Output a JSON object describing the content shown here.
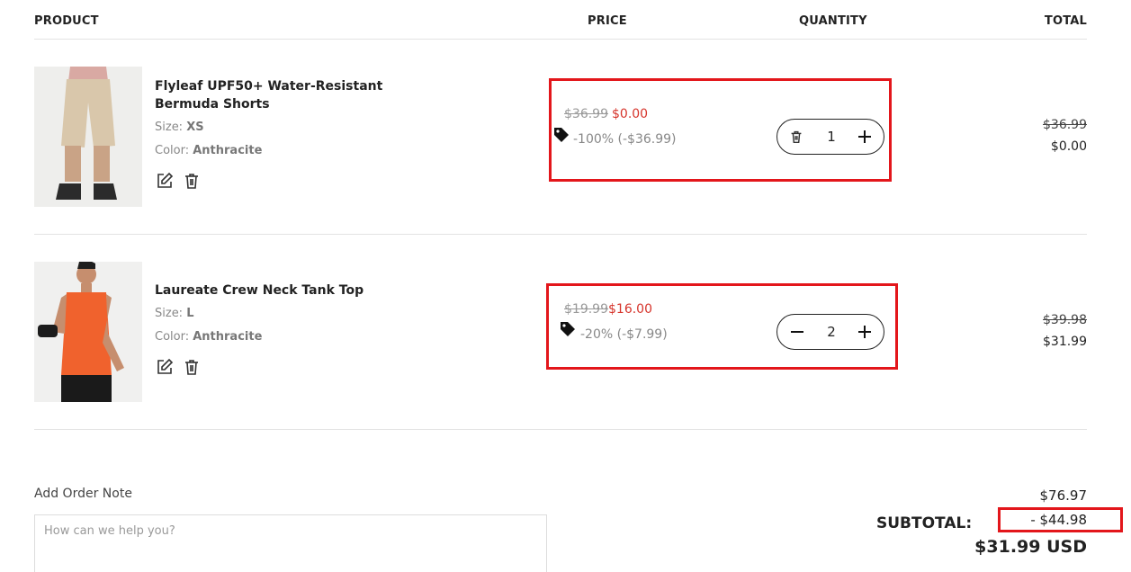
{
  "headers": {
    "product": "PRODUCT",
    "price": "PRICE",
    "quantity": "QUANTITY",
    "total": "TOTAL"
  },
  "items": [
    {
      "name": "Flyleaf UPF50+ Water-Resistant Bermuda Shorts",
      "size_label": "Size:",
      "size": "XS",
      "color_label": "Color:",
      "color": "Anthracite",
      "price_original": "$36.99",
      "price_sale": "$0.00",
      "discount": "-100% (-$36.99)",
      "quantity": "1",
      "total_original": "$36.99",
      "total_sale": "$0.00",
      "image_icon": "shorts-product-photo"
    },
    {
      "name": "Laureate Crew Neck Tank Top",
      "size_label": "Size:",
      "size": "L",
      "color_label": "Color:",
      "color": "Anthracite",
      "price_original": "$19.99",
      "price_sale": "$16.00",
      "discount": "-20% (-$7.99)",
      "quantity": "2",
      "total_original": "$39.98",
      "total_sale": "$31.99",
      "image_icon": "tank-top-product-photo"
    }
  ],
  "order_note": {
    "label": "Add Order Note",
    "placeholder": "How can we help you?"
  },
  "summary": {
    "raw_total": "$76.97",
    "subtotal_label": "SUBTOTAL:",
    "discount": "- $44.98",
    "final_total": "$31.99 USD"
  },
  "colors": {
    "sale_red": "#d6342b",
    "highlight_red": "#e3161b",
    "tank_orange": "#f0622d"
  }
}
